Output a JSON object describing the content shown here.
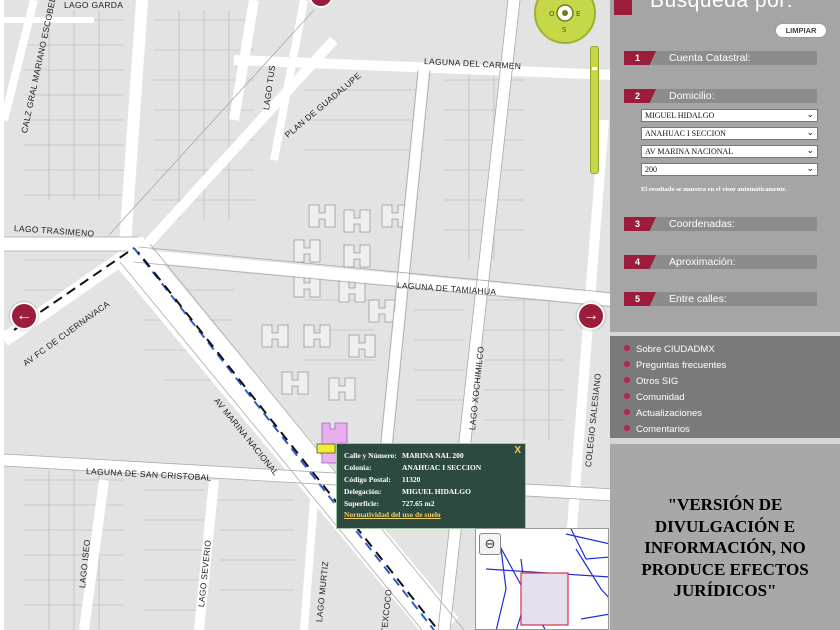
{
  "search": {
    "title": "Búsqueda por:",
    "clear_label": "LIMPIAR",
    "sections": [
      {
        "num": "1",
        "label": "Cuenta Catastral:"
      },
      {
        "num": "2",
        "label": "Domicilio:"
      },
      {
        "num": "3",
        "label": "Coordenadas:"
      },
      {
        "num": "4",
        "label": "Aproximación:"
      },
      {
        "num": "5",
        "label": "Entre calles:"
      }
    ],
    "domicilio": {
      "delegacion": "MIGUEL HIDALGO",
      "colonia": "ANAHUAC I SECCION",
      "calle": "AV MARINA NACIONAL",
      "numero": "200",
      "note": "El resultado se muestra en el visor automáticamente."
    }
  },
  "links": [
    "Sobre CIUDADMX",
    "Preguntas frecuentes",
    "Otros SIG",
    "Comunidad",
    "Actualizaciones",
    "Comentarios"
  ],
  "disclaimer": "\"VERSIÓN DE DIVULGACIÓN E INFORMACIÓN, NO PRODUCE EFECTOS JURÍDICOS\"",
  "map": {
    "streets": {
      "lago_garda": "LAGO GARDA",
      "calz_gral": "CALZ GRAL MARIANO ESCOBEDO",
      "lago_tus": "LAGO TUS",
      "plan_guadalupe": "PLAN DE GUADALUPE",
      "laguna_carmen": "LAGUNA DEL CARMEN",
      "lago_trasimeno": "LAGO TRASIMENO",
      "laguna_tamiahua": "LAGUNA DE TAMIAHUA",
      "av_fc_cuernavaca": "AV FC DE CUERNAVACA",
      "av_marina": "AV MARINA NACIONAL",
      "lago_xochimilco": "LAGO XOCHIMILCO",
      "colegio_salesiano": "COLEGIO SALESIANO",
      "laguna_san_cristobal": "LAGUNA DE SAN CRISTOBAL",
      "lago_iseo": "LAGO ISEO",
      "lago_severio": "LAGO SEVERIO",
      "lago_murtiz": "LAGO MURTIZ",
      "texcoco": "TEXCOCO"
    },
    "popup": {
      "close": "X",
      "rows": [
        {
          "k": "Calle y Número:",
          "v": "MARINA NAL 200"
        },
        {
          "k": "Colonia:",
          "v": "ANAHUAC I SECCION"
        },
        {
          "k": "Código Postal:",
          "v": "11320"
        },
        {
          "k": "Delegación:",
          "v": "MIGUEL HIDALGO"
        },
        {
          "k": "Superficie:",
          "v": "727.65 m2"
        }
      ],
      "link": "Normatividad del uso de suelo"
    },
    "icons": {
      "pan_left": "arrow-left-icon",
      "pan_right": "arrow-right-icon",
      "overview_zoom": "zoom-out-icon",
      "compass": "compass-icon"
    },
    "colors": {
      "accent": "#9b1c3b",
      "popup_bg": "#2c4a3f",
      "parcel_highlight": "#e8b0ef",
      "zoom_control": "#c6d84a"
    }
  }
}
